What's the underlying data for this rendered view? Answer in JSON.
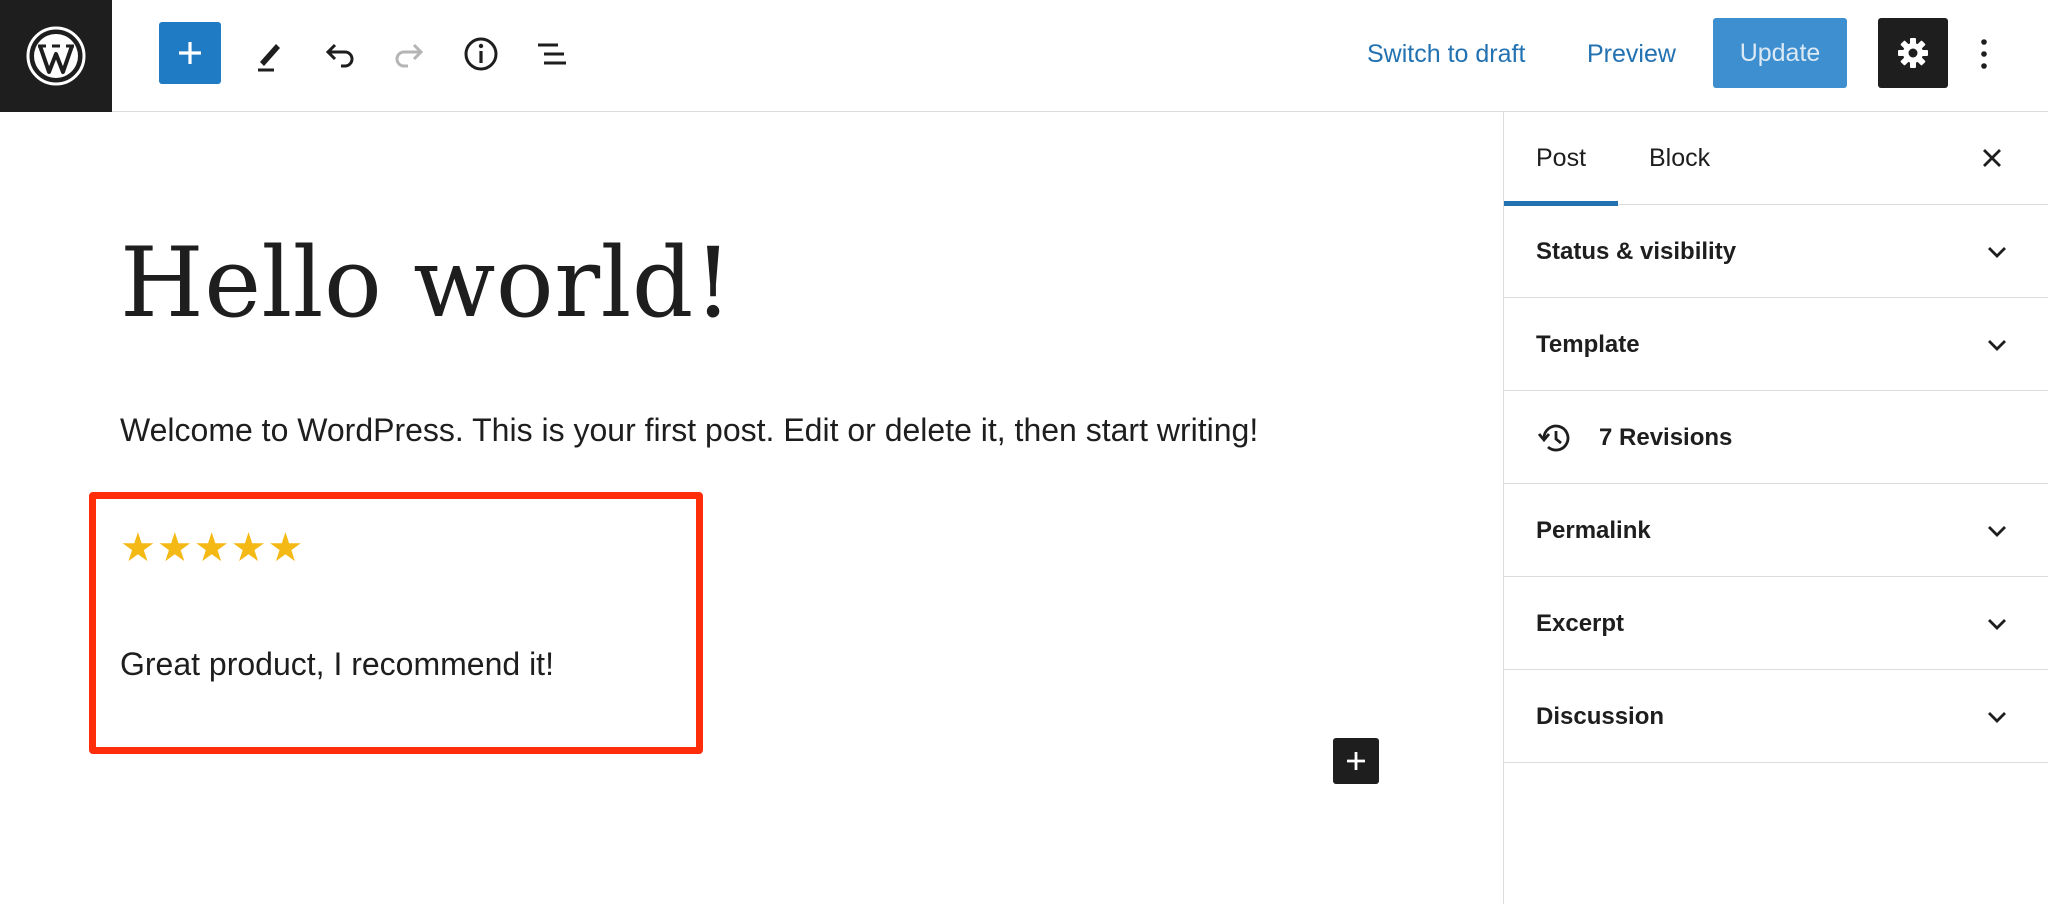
{
  "toolbar": {
    "switch_to_draft": "Switch to draft",
    "preview": "Preview",
    "update": "Update"
  },
  "post": {
    "title": "Hello world!",
    "paragraph": "Welcome to WordPress. This is your first post. Edit or delete it, then start writing!",
    "rating_stars": "★★★★★",
    "rating_value": 5,
    "rating_max": 5,
    "review_text": "Great product, I recommend it!"
  },
  "sidebar": {
    "tabs": [
      "Post",
      "Block"
    ],
    "panels": [
      {
        "label": "Status & visibility"
      },
      {
        "label": "Template"
      },
      {
        "label": "7 Revisions"
      },
      {
        "label": "Permalink"
      },
      {
        "label": "Excerpt"
      },
      {
        "label": "Discussion"
      }
    ]
  },
  "icons": {
    "logo": "wordpress-logo-icon",
    "inserter": "plus-icon",
    "tools": "pencil-icon",
    "undo": "undo-icon",
    "redo": "redo-icon",
    "details": "info-icon",
    "list_view": "list-view-icon",
    "settings": "gear-icon",
    "more": "more-vertical-icon",
    "close": "close-icon",
    "chevron": "chevron-down-icon",
    "revisions": "history-icon",
    "add_block": "plus-icon"
  },
  "colors": {
    "accent": "#2271b1",
    "inserter_bg": "#1e7bc4",
    "update_bg": "#3d8fd0",
    "dark": "#1e1e1e",
    "star": "#f5b915",
    "highlight": "#ff2d0a"
  }
}
